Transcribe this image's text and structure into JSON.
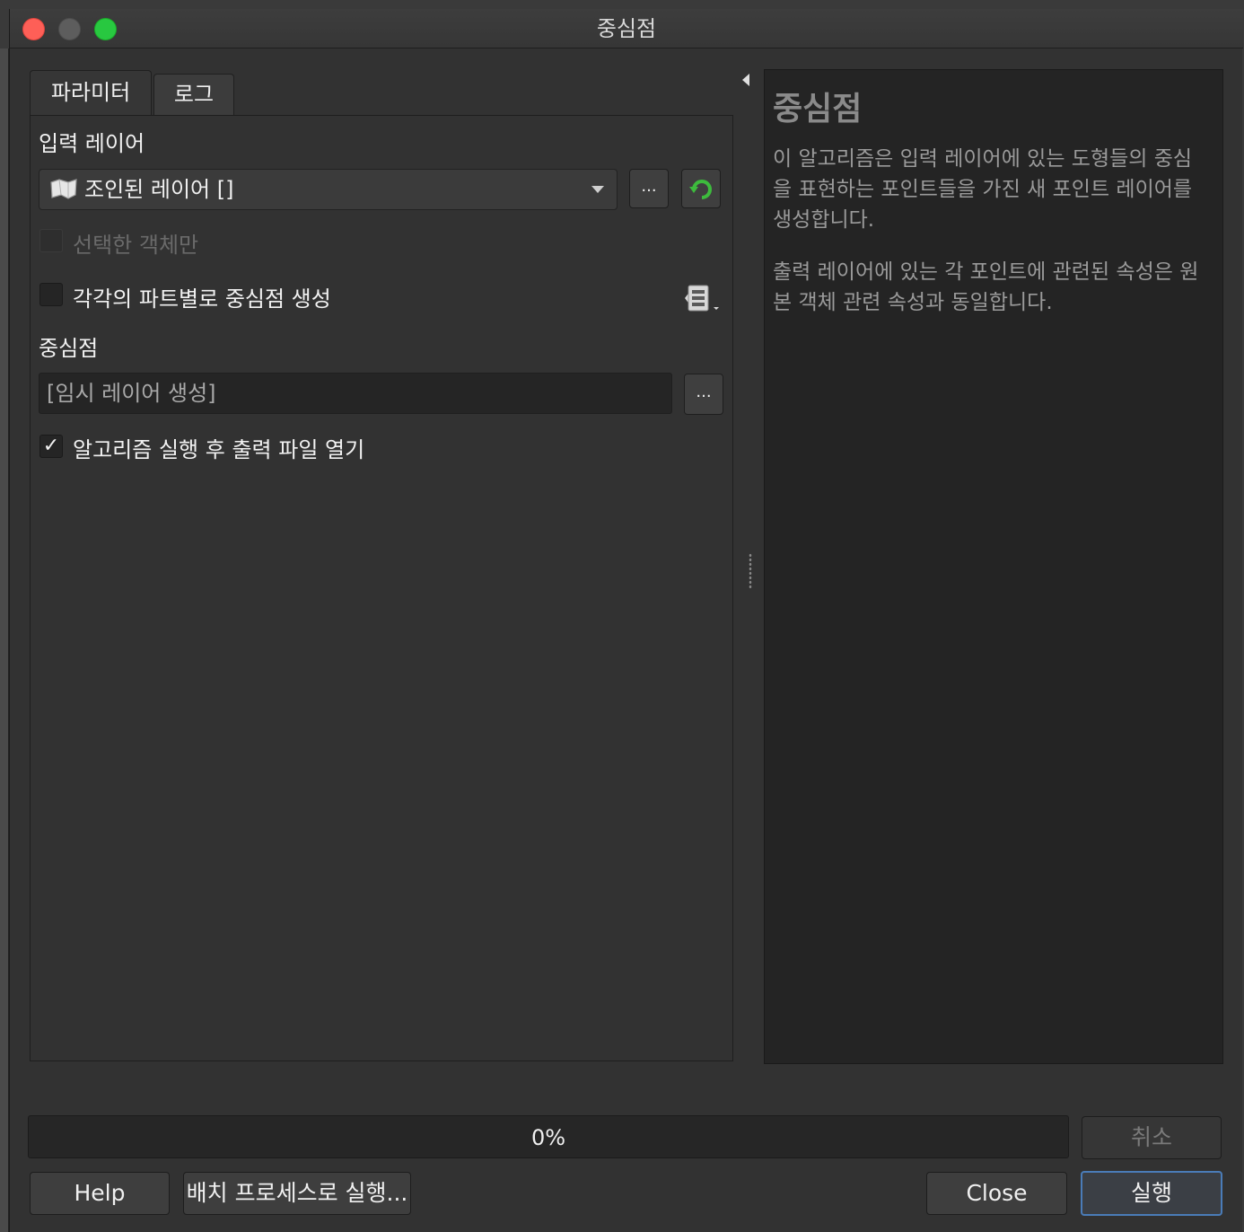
{
  "window": {
    "title": "중심점"
  },
  "tabs": [
    {
      "label": "파라미터",
      "active": true
    },
    {
      "label": "로그",
      "active": false
    }
  ],
  "parameters": {
    "input_layer_label": "입력 레이어",
    "input_layer_value": "조인된 레이어 []",
    "browse_label": "...",
    "selected_only_label": "선택한 객체만",
    "selected_only_checked": false,
    "selected_only_enabled": false,
    "each_part_label": "각각의 파트별로 중심점 생성",
    "each_part_checked": false,
    "output_label": "중심점",
    "output_value": "[임시 레이어 생성]",
    "output_browse_label": "...",
    "open_output_label": "알고리즘 실행 후 출력 파일 열기",
    "open_output_checked": true,
    "checkmark": "✓"
  },
  "help": {
    "title": "중심점",
    "paragraphs": [
      "이 알고리즘은 입력 레이어에 있는 도형들의 중심을 표현하는 포인트들을 가진 새 포인트 레이어를 생성합니다.",
      "출력 레이어에 있는 각 포인트에 관련된 속성은 원본 객체 관련 속성과 동일합니다."
    ]
  },
  "progress": {
    "percent": 0,
    "label": "0%"
  },
  "buttons": {
    "cancel": "취소",
    "help": "Help",
    "batch": "배치 프로세스로 실행...",
    "close": "Close",
    "run": "실행"
  },
  "icons": {
    "layer_type": "polygon-layer-icon",
    "refresh": "refresh-icon",
    "iterate": "iterate-features-icon",
    "collapse": "collapse-arrow-icon"
  },
  "colors": {
    "accent": "#4a7cb8",
    "close_light": "#fe5f57",
    "min_light": "#5d5d5d",
    "max_light": "#28c840",
    "refresh_green": "#3dbb3d"
  }
}
